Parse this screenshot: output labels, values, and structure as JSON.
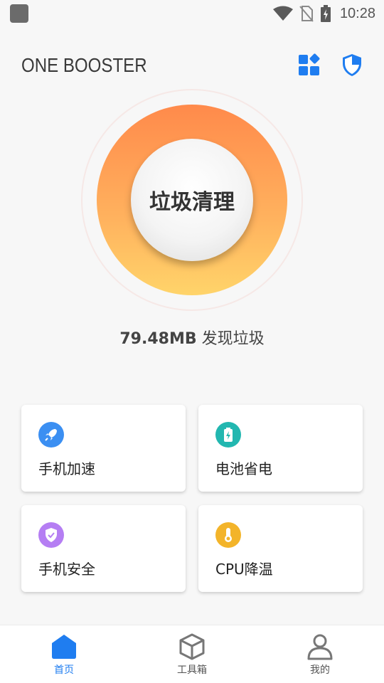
{
  "status_bar": {
    "time": "10:28",
    "icons": [
      "app-notification-icon",
      "wifi-icon",
      "no-sim-icon",
      "battery-charging-icon"
    ]
  },
  "header": {
    "title": "ONE BOOSTER",
    "icons": [
      "apps-grid-icon",
      "shield-icon"
    ]
  },
  "cleaner": {
    "button_label": "垃圾清理",
    "junk_size": "79.48MB",
    "junk_suffix": "发现垃圾"
  },
  "features": [
    {
      "label": "手机加速",
      "icon": "rocket-icon",
      "color": "#3b8ff2"
    },
    {
      "label": "电池省电",
      "icon": "battery-icon",
      "color": "#22b7b0"
    },
    {
      "label": "手机安全",
      "icon": "shield-check-icon",
      "color": "#b57ef3"
    },
    {
      "label": "CPU降温",
      "icon": "thermometer-icon",
      "color": "#f3b42a"
    }
  ],
  "bottom_nav": [
    {
      "label": "首页",
      "icon": "home-icon",
      "active": true
    },
    {
      "label": "工具箱",
      "icon": "toolbox-icon",
      "active": false
    },
    {
      "label": "我的",
      "icon": "profile-icon",
      "active": false
    }
  ],
  "colors": {
    "accent": "#1f7df0",
    "ring_top": "#ff8a4b",
    "ring_bottom": "#ffd46a"
  }
}
